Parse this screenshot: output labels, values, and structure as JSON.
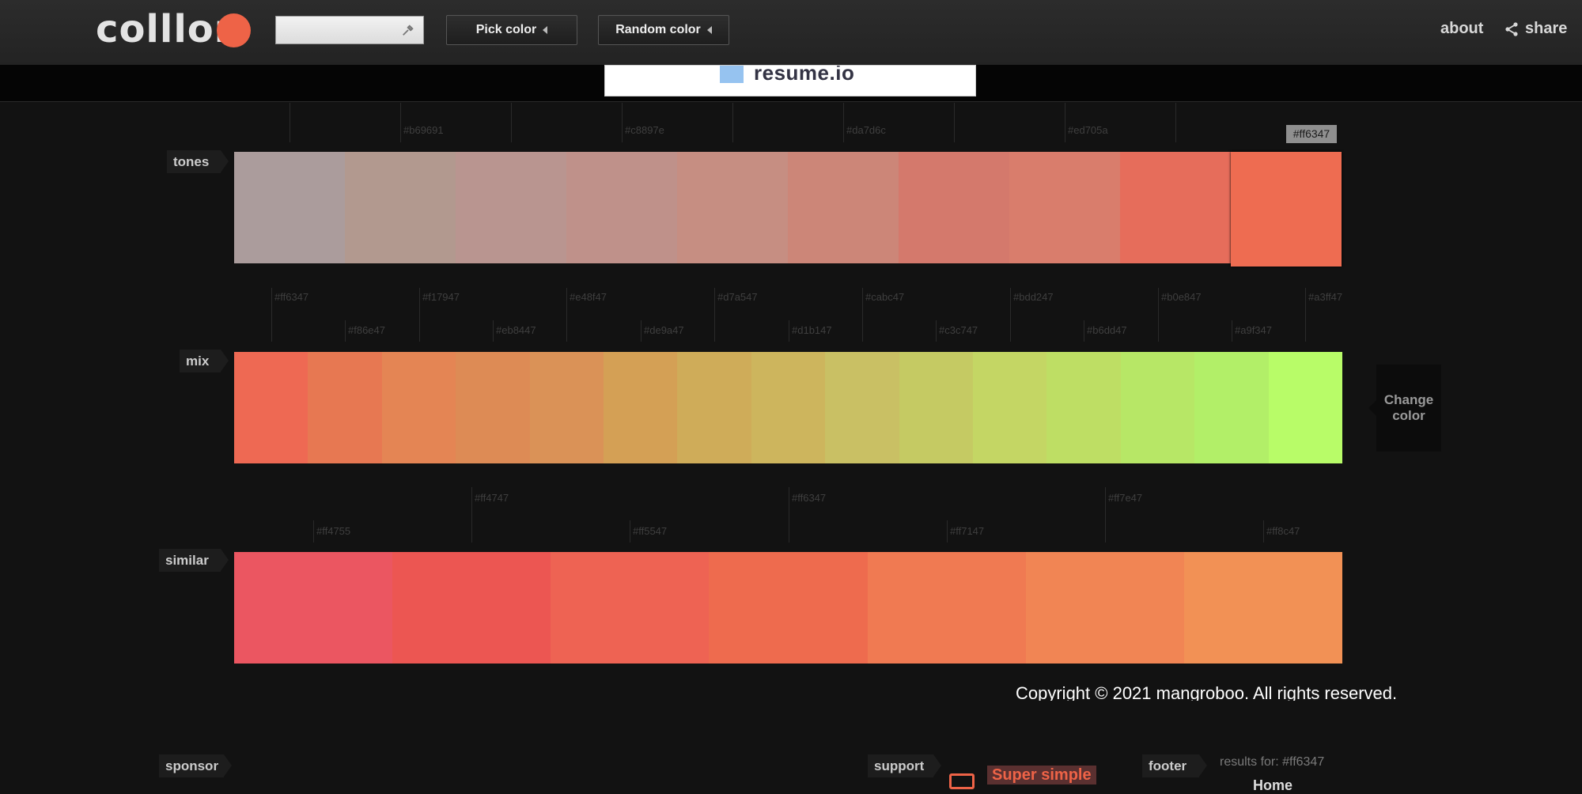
{
  "header": {
    "logo": "colllor:",
    "current_color": "#ee6347",
    "search_value": "",
    "pick_label": "Pick color",
    "random_label": "Random color",
    "about_label": "about",
    "share_label": "share"
  },
  "ad": {
    "text": "resume.io"
  },
  "tones": {
    "label": "tones",
    "selected_hex": "#ff6347",
    "swatches": [
      "#ab9c9c",
      "#b2998f",
      "#b99590",
      "#bf918a",
      "#c68e82",
      "#cc8678",
      "#d4796c",
      "#d97d6c",
      "#e66d5b",
      "#ee6c51"
    ],
    "hex_labels": [
      "#b69691",
      "#c8897e",
      "#da7d6c",
      "#ed705a"
    ]
  },
  "mix": {
    "label": "mix",
    "swatches": [
      "#ee6953",
      "#e77852",
      "#e48554",
      "#dd8b55",
      "#da9257",
      "#d4a055",
      "#cfac59",
      "#cdb55d",
      "#c9c064",
      "#c5ca63",
      "#c4d664",
      "#bede64",
      "#b7e766",
      "#b2ef68",
      "#b8fc68"
    ],
    "hex_top": [
      "#ff6347",
      "#f17947",
      "#e48f47",
      "#d7a547",
      "#cabc47",
      "#bdd247",
      "#b0e847",
      "#a3ff47"
    ],
    "hex_bottom": [
      "#f86e47",
      "#eb8447",
      "#de9a47",
      "#d1b147",
      "#c3c747",
      "#b6dd47",
      "#a9f347"
    ],
    "change_label": "Change color"
  },
  "similar": {
    "label": "similar",
    "swatches": [
      "#eb5661",
      "#ec5652",
      "#ee6353",
      "#ee6b4e",
      "#f07a52",
      "#f18554",
      "#f29155"
    ],
    "hex_top": [
      "#ff4747",
      "#ff6347",
      "#ff7e47"
    ],
    "hex_bottom": [
      "#ff4755",
      "#ff5547",
      "#ff7147",
      "#ff8c47"
    ]
  },
  "footer": {
    "copyright": "Copyright © 2021 mangroboo. All rights reserved.",
    "sponsor_label": "sponsor",
    "support_label": "support",
    "support_text": "Super simple",
    "footer_label": "footer",
    "results": "results for: #ff6347",
    "home": "Home"
  }
}
